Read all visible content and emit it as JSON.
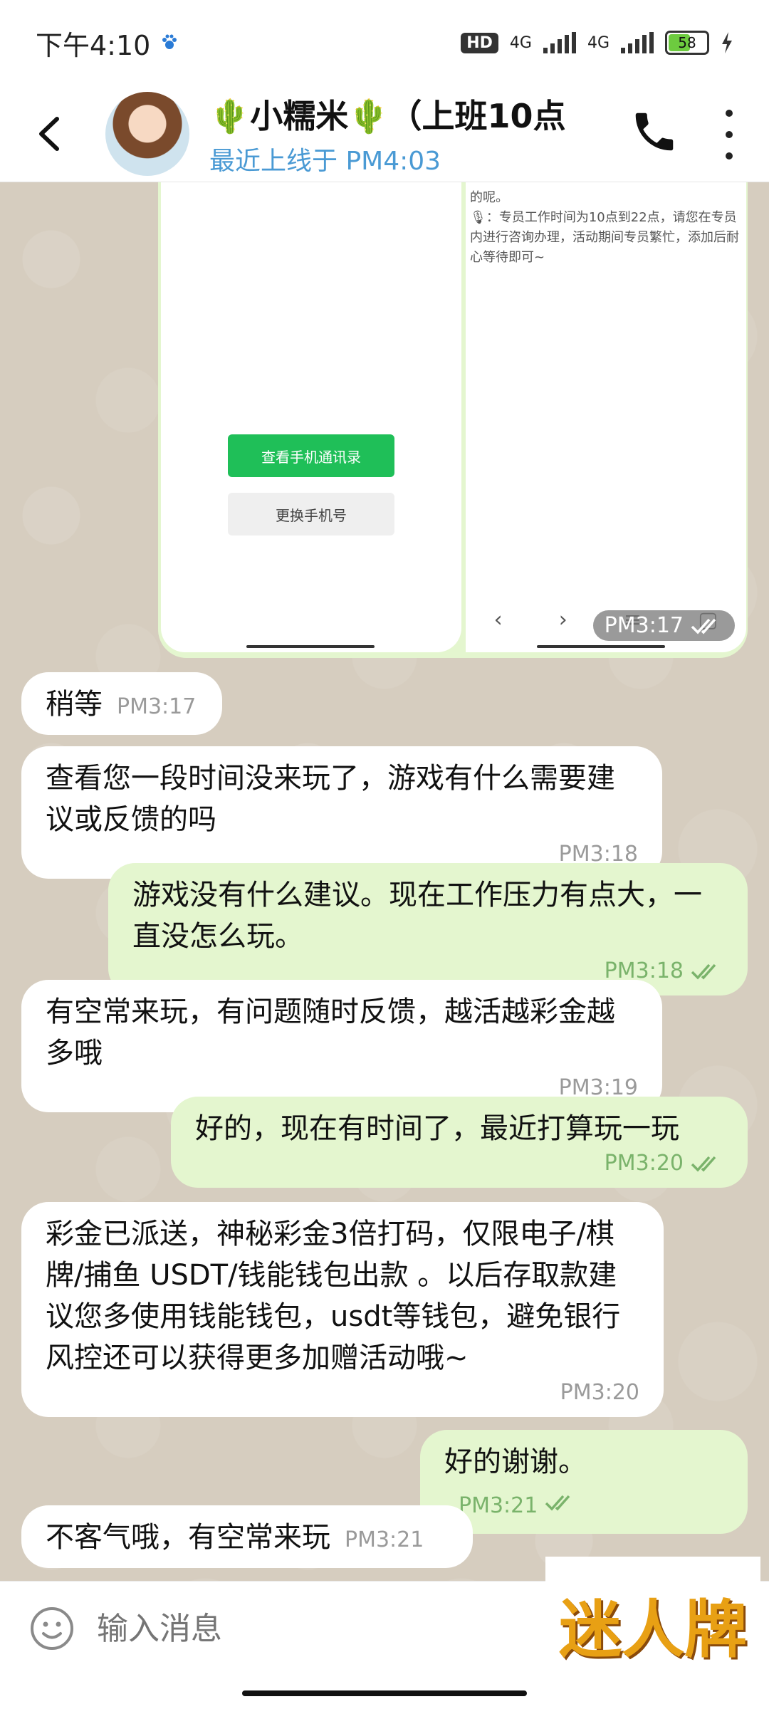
{
  "status_bar": {
    "time": "下午4:10",
    "hd": "HD",
    "net1": "4G",
    "net2": "4G",
    "battery": "58"
  },
  "header": {
    "contact_name": "🌵小糯米🌵（上班10点",
    "last_seen": "最近上线于 PM4:03"
  },
  "image_message": {
    "right_text": "的呢。\n🎙：专员工作时间为10点到22点，请您在专员内进行咨询办理，活动期间专员繁忙，添加后耐心等待即可~",
    "btn_contacts": "查看手机通讯录",
    "btn_change_phone": "更换手机号",
    "time": "PM3:17"
  },
  "messages": [
    {
      "dir": "in",
      "text": "稍等",
      "time": "PM3:17"
    },
    {
      "dir": "in",
      "text": "查看您一段时间没来玩了，游戏有什么需要建议或反馈的吗",
      "time": "PM3:18"
    },
    {
      "dir": "out",
      "text": "游戏没有什么建议。现在工作压力有点大，一直没怎么玩。",
      "time": "PM3:18"
    },
    {
      "dir": "in",
      "text": "有空常来玩，有问题随时反馈，越活越彩金越多哦",
      "time": "PM3:19"
    },
    {
      "dir": "out",
      "text": "好的，现在有时间了，最近打算玩一玩",
      "time": "PM3:20"
    },
    {
      "dir": "in",
      "text": "彩金已派送，神秘彩金3倍打码，仅限电子/棋牌/捕鱼 USDT/钱能钱包出款 。以后存取款建议您多使用钱能钱包，usdt等钱包，避免银行风控还可以获得更多加赠活动哦~",
      "time": "PM3:20"
    },
    {
      "dir": "out",
      "text": "好的谢谢。",
      "time": "PM3:21"
    },
    {
      "dir": "in",
      "text": "不客气哦，有空常来玩",
      "time": "PM3:21"
    }
  ],
  "input": {
    "placeholder": "输入消息"
  },
  "watermark": "迷人牌",
  "colors": {
    "outgoing_bubble": "#e4f6cf",
    "incoming_bubble": "#ffffff",
    "status_link": "#4a9ad4",
    "read_check": "#7ab36b"
  },
  "icons": [
    "back-arrow-icon",
    "phone-icon",
    "more-vert-icon",
    "emoji-icon",
    "double-check-icon",
    "charging-icon",
    "baidu-paw-icon"
  ]
}
